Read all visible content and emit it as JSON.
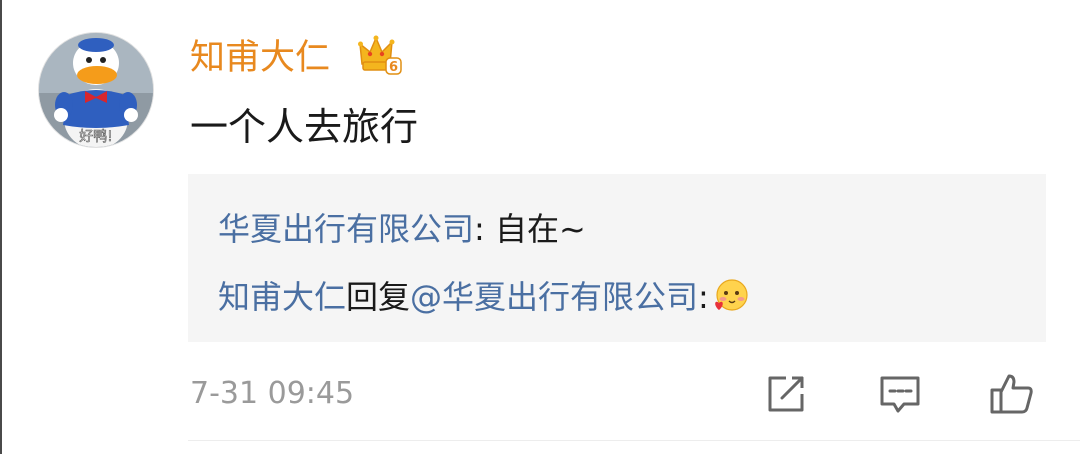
{
  "comment": {
    "username": "知甫大仁",
    "vip_level": "6",
    "avatar_caption": "好鸭!",
    "text": "一个人去旅行",
    "timestamp": "7-31 09:45"
  },
  "reply_box": {
    "line1": {
      "author": "华夏出行有限公司",
      "separator": ": ",
      "text": "自在~"
    },
    "line2": {
      "author": "知甫大仁",
      "action": "回复",
      "mention": "@华夏出行有限公司",
      "separator": ":",
      "emoji": "blush-heart-emoji"
    }
  },
  "actions": {
    "share_icon": "edit-share-icon",
    "comment_icon": "comment-icon",
    "like_icon": "thumbs-up-icon"
  },
  "colors": {
    "username": "#e8891f",
    "link": "#4a6fa2",
    "reply_bg": "#f5f5f5",
    "timestamp": "#9a9a9a"
  }
}
